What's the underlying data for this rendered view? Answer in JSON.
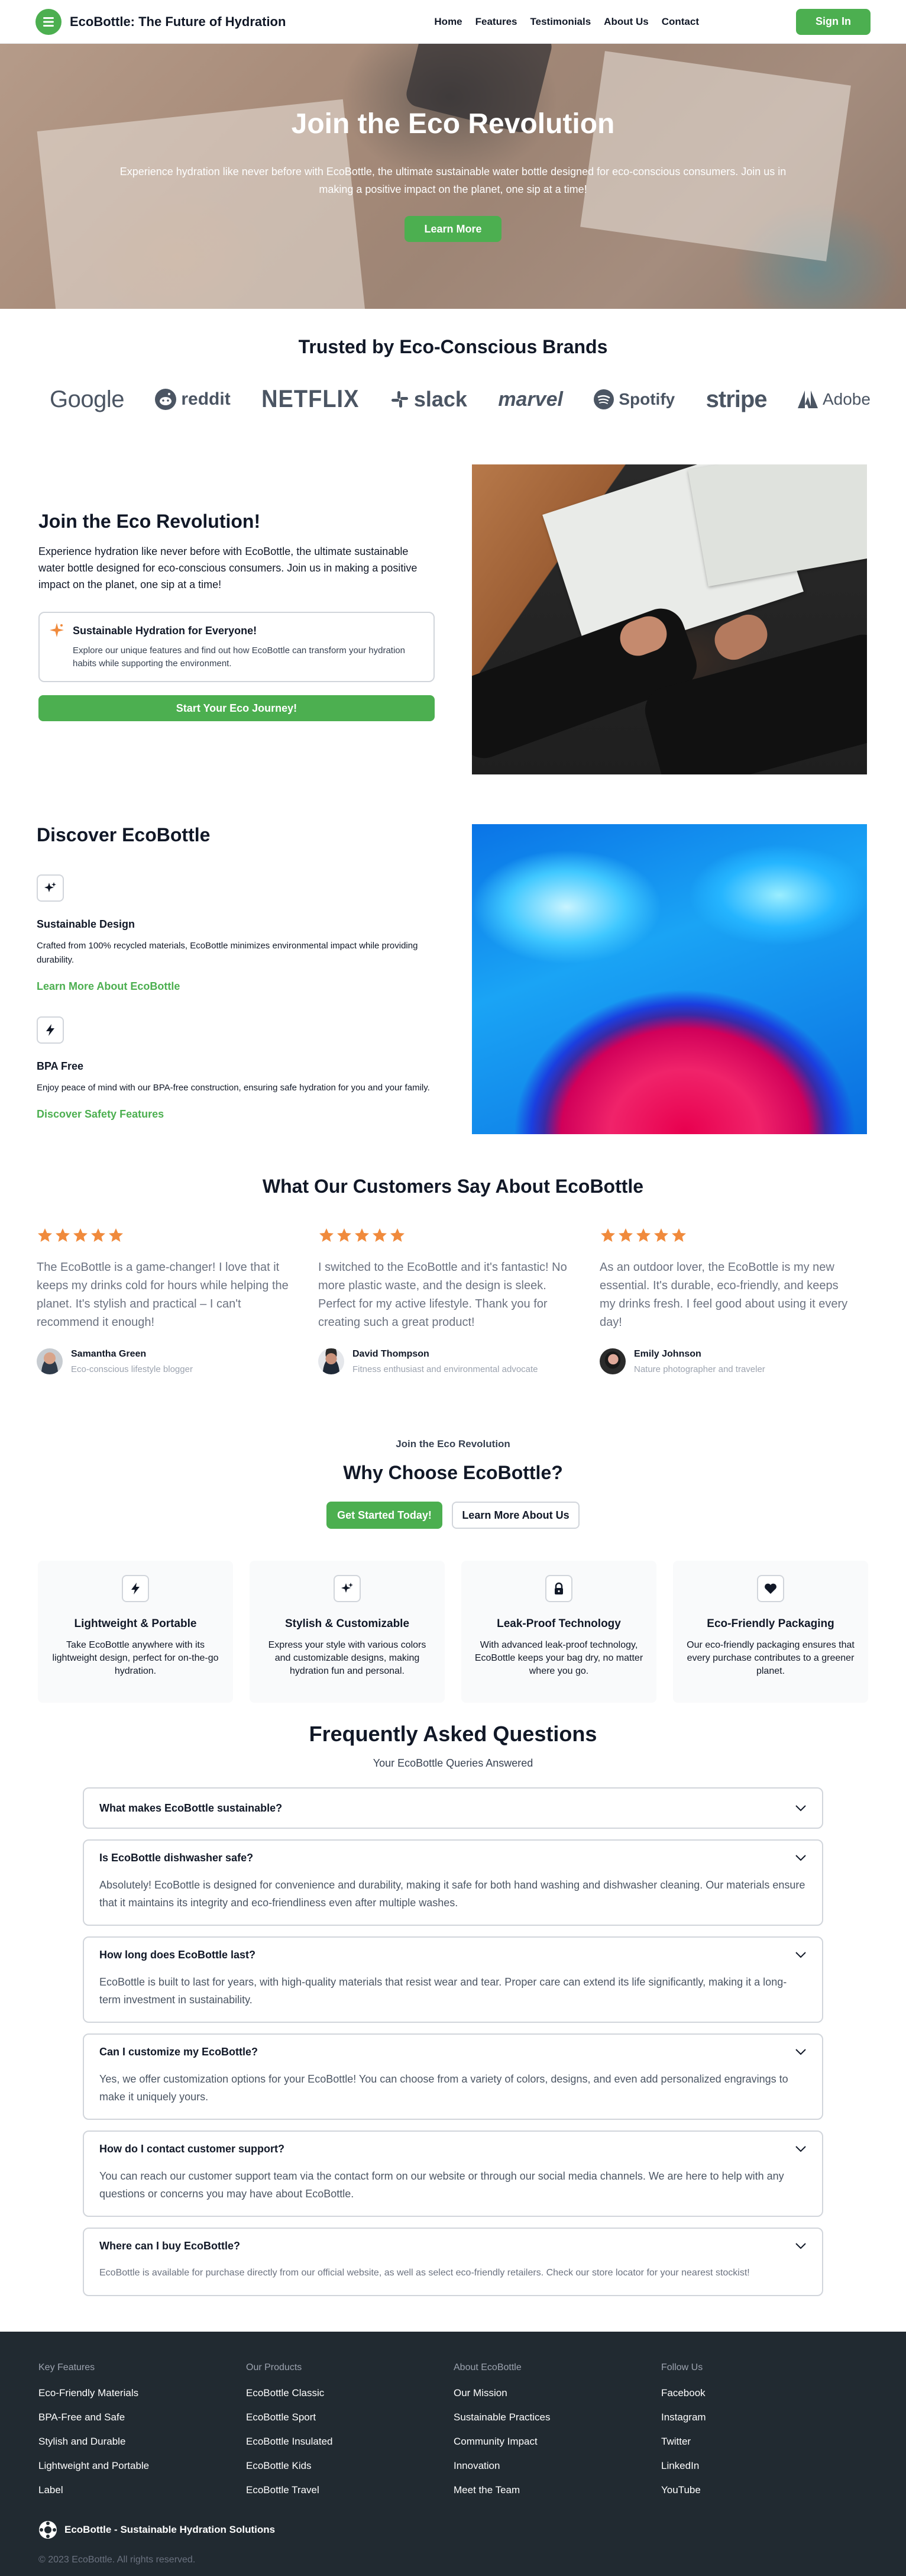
{
  "nav": {
    "brand": "EcoBottle: The Future of Hydration",
    "links": [
      "Home",
      "Features",
      "Testimonials",
      "About Us",
      "Contact"
    ],
    "signin": "Sign In"
  },
  "hero": {
    "title": "Join the Eco Revolution",
    "body": "Experience hydration like never before with EcoBottle, the ultimate sustainable water bottle designed for eco-conscious consumers. Join us in making a positive impact on the planet, one sip at a time!",
    "cta": "Learn More"
  },
  "brands": {
    "title": "Trusted by Eco-Conscious Brands",
    "logos": [
      "Google",
      "reddit",
      "NETFLIX",
      "slack",
      "marvel",
      "Spotify",
      "stripe",
      "Adobe"
    ]
  },
  "join": {
    "title": "Join the Eco Revolution!",
    "body": "Experience hydration like never before with EcoBottle, the ultimate sustainable water bottle designed for eco-conscious consumers. Join us in making a positive impact on the planet, one sip at a time!",
    "card_title": "Sustainable Hydration for Everyone!",
    "card_body": "Explore our unique features and find out how EcoBottle can transform your hydration habits while supporting the environment.",
    "cta": "Start Your Eco Journey!"
  },
  "discover": {
    "title": "Discover EcoBottle",
    "features": [
      {
        "icon": "sparkle-icon",
        "title": "Sustainable Design",
        "body": "Crafted from 100% recycled materials, EcoBottle minimizes environmental impact while providing durability.",
        "link": "Learn More About EcoBottle"
      },
      {
        "icon": "lightning-icon",
        "title": "BPA Free",
        "body": "Enjoy peace of mind with our BPA-free construction, ensuring safe hydration for you and your family.",
        "link": "Discover Safety Features"
      }
    ]
  },
  "testimonials": {
    "title": "What Our Customers Say About EcoBottle",
    "rating": 5,
    "items": [
      {
        "quote": "The EcoBottle is a game-changer! I love that it keeps my drinks cold for hours while helping the planet. It's stylish and practical – I can't recommend it enough!",
        "name": "Samantha Green",
        "role": "Eco-conscious lifestyle blogger"
      },
      {
        "quote": "I switched to the EcoBottle and it's fantastic! No more plastic waste, and the design is sleek. Perfect for my active lifestyle. Thank you for creating such a great product!",
        "name": "David Thompson",
        "role": "Fitness enthusiast and environmental advocate"
      },
      {
        "quote": "As an outdoor lover, the EcoBottle is my new essential. It's durable, eco-friendly, and keeps my drinks fresh. I feel good about using it every day!",
        "name": "Emily Johnson",
        "role": "Nature photographer and traveler"
      }
    ]
  },
  "why": {
    "kicker": "Join the Eco Revolution",
    "title": "Why Choose EcoBottle?",
    "primary": "Get Started Today!",
    "secondary": "Learn More About Us",
    "features": [
      {
        "icon": "lightning-icon",
        "title": "Lightweight & Portable",
        "body": "Take EcoBottle anywhere with its lightweight design, perfect for on-the-go hydration."
      },
      {
        "icon": "sparkle-icon",
        "title": "Stylish & Customizable",
        "body": "Express your style with various colors and customizable designs, making hydration fun and personal."
      },
      {
        "icon": "lock-icon",
        "title": "Leak-Proof Technology",
        "body": "With advanced leak-proof technology, EcoBottle keeps your bag dry, no matter where you go."
      },
      {
        "icon": "heart-icon",
        "title": "Eco-Friendly Packaging",
        "body": "Our eco-friendly packaging ensures that every purchase contributes to a greener planet."
      }
    ]
  },
  "faq": {
    "title": "Frequently Asked Questions",
    "subtitle": "Your EcoBottle Queries Answered",
    "items": [
      {
        "q": "What makes EcoBottle sustainable?",
        "a": ""
      },
      {
        "q": "Is EcoBottle dishwasher safe?",
        "a": "Absolutely! EcoBottle is designed for convenience and durability, making it safe for both hand washing and dishwasher cleaning. Our materials ensure that it maintains its integrity and eco-friendliness even after multiple washes."
      },
      {
        "q": "How long does EcoBottle last?",
        "a": "EcoBottle is built to last for years, with high-quality materials that resist wear and tear. Proper care can extend its life significantly, making it a long-term investment in sustainability."
      },
      {
        "q": "Can I customize my EcoBottle?",
        "a": "Yes, we offer customization options for your EcoBottle! You can choose from a variety of colors, designs, and even add personalized engravings to make it uniquely yours."
      },
      {
        "q": "How do I contact customer support?",
        "a": "You can reach our customer support team via the contact form on our website or through our social media channels. We are here to help with any questions or concerns you may have about EcoBottle."
      },
      {
        "q": "Where can I buy EcoBottle?",
        "a": "EcoBottle is available for purchase directly from our official website, as well as select eco-friendly retailers. Check our store locator for your nearest stockist!"
      }
    ]
  },
  "footer": {
    "columns": [
      {
        "title": "Key Features",
        "items": [
          "Eco-Friendly Materials",
          "BPA-Free and Safe",
          "Stylish and Durable",
          "Lightweight and Portable",
          "Label"
        ]
      },
      {
        "title": "Our Products",
        "items": [
          "EcoBottle Classic",
          "EcoBottle Sport",
          "EcoBottle Insulated",
          "EcoBottle Kids",
          "EcoBottle Travel"
        ]
      },
      {
        "title": "About EcoBottle",
        "items": [
          "Our Mission",
          "Sustainable Practices",
          "Community Impact",
          "Innovation",
          "Meet the Team"
        ]
      },
      {
        "title": "Follow Us",
        "items": [
          "Facebook",
          "Instagram",
          "Twitter",
          "LinkedIn",
          "YouTube"
        ]
      }
    ],
    "brand": "EcoBottle - Sustainable Hydration Solutions",
    "copyright": "© 2023 EcoBottle. All rights reserved."
  },
  "colors": {
    "accent": "#4caf50",
    "star": "#f08a3c",
    "footer_bg": "#212a31"
  }
}
